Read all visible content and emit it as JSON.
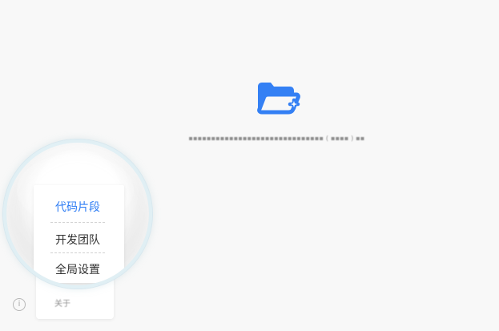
{
  "menu": {
    "items": [
      {
        "label": "代码片段"
      },
      {
        "label": "开发团队"
      },
      {
        "label": "全局设置"
      },
      {
        "label": "关于"
      }
    ]
  },
  "colors": {
    "background": "#f8f8f8",
    "accent": "#2d7cf4",
    "text": "#2f2f2f",
    "muted": "#8d8d8d",
    "lens_border": "#e0eff5"
  },
  "icons": {
    "folder": "folder-plus-icon",
    "info": "info-icon"
  }
}
